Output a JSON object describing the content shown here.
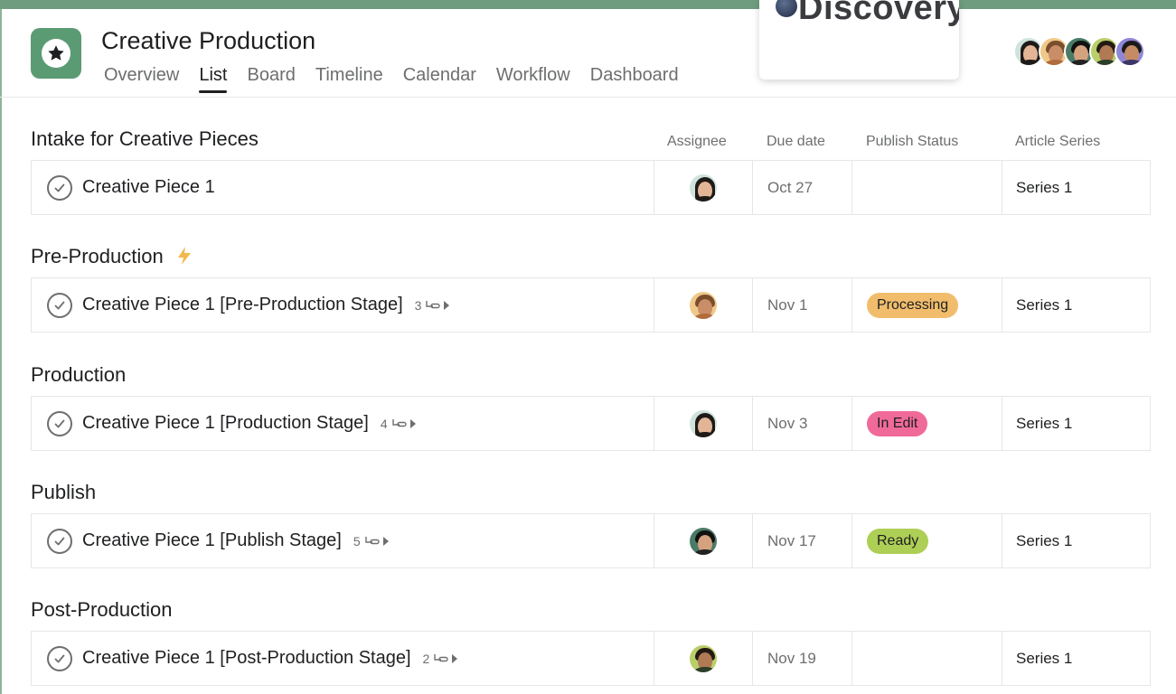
{
  "header": {
    "title": "Creative Production",
    "tabs": [
      {
        "label": "Overview"
      },
      {
        "label": "List"
      },
      {
        "label": "Board"
      },
      {
        "label": "Timeline"
      },
      {
        "label": "Calendar"
      },
      {
        "label": "Workflow"
      },
      {
        "label": "Dashboard"
      }
    ],
    "active_tab": "List",
    "logo_text": "Discovery",
    "app_icon": "star-icon"
  },
  "columns": {
    "assignee": "Assignee",
    "due_date": "Due date",
    "publish_status": "Publish Status",
    "article_series": "Article Series"
  },
  "sections": [
    {
      "title": "Intake for Creative Pieces",
      "icon": "",
      "task": {
        "name": "Creative Piece 1",
        "subtasks": "",
        "due": "Oct 27",
        "status": "",
        "series": "Series 1"
      }
    },
    {
      "title": "Pre-Production",
      "icon": "lightning-icon",
      "task": {
        "name": "Creative Piece 1 [Pre-Production Stage]",
        "subtasks": "3",
        "due": "Nov 1",
        "status": "Processing",
        "series": "Series 1"
      }
    },
    {
      "title": "Production",
      "icon": "",
      "task": {
        "name": "Creative Piece 1 [Production Stage]",
        "subtasks": "4",
        "due": "Nov 3",
        "status": "In Edit",
        "series": "Series 1"
      }
    },
    {
      "title": "Publish",
      "icon": "",
      "task": {
        "name": "Creative Piece 1 [Publish Stage]",
        "subtasks": "5",
        "due": "Nov 17",
        "status": "Ready",
        "series": "Series 1"
      }
    },
    {
      "title": "Post-Production",
      "icon": "",
      "task": {
        "name": "Creative Piece 1 [Post-Production Stage]",
        "subtasks": "2",
        "due": "Nov 19",
        "status": "",
        "series": "Series 1"
      }
    }
  ],
  "status_colors": {
    "Processing": "#f1bd6c",
    "In Edit": "#f06a99",
    "Ready": "#aecf55"
  },
  "colors": {
    "app_icon_bg": "#5b9b74",
    "top_strip": "#6f9b7e"
  }
}
